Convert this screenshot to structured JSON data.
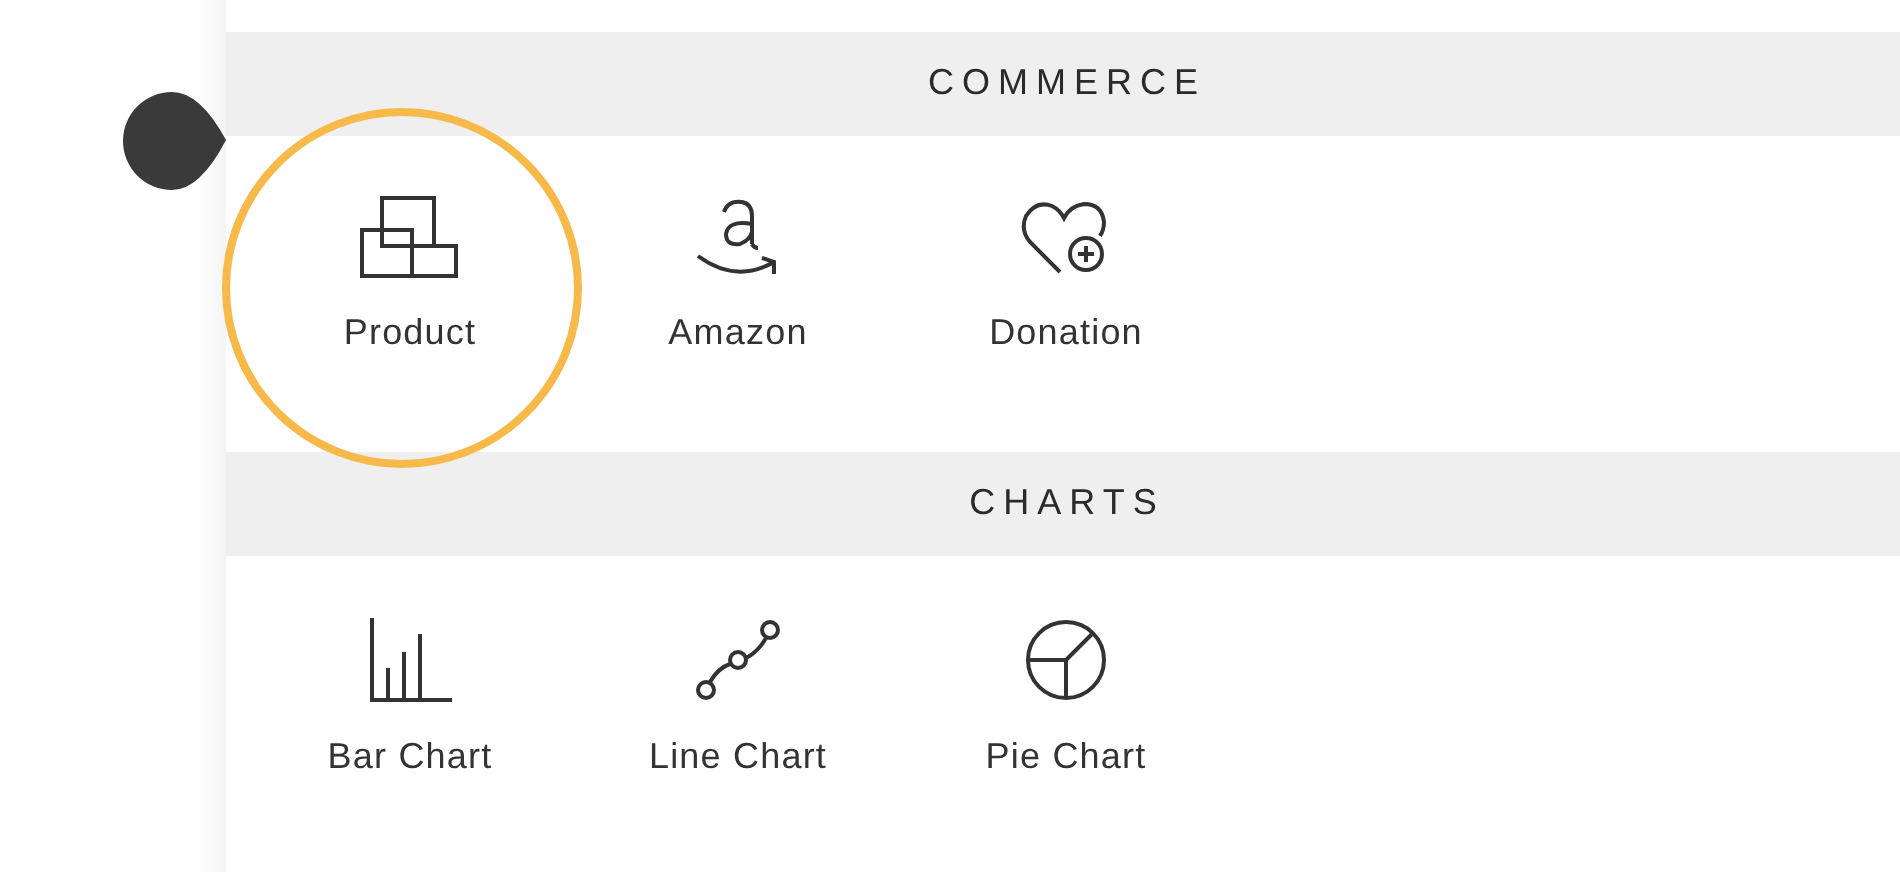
{
  "sections": [
    {
      "title": "COMMERCE",
      "items": [
        {
          "label": "Product",
          "kind": "boxes",
          "highlighted": true
        },
        {
          "label": "Amazon",
          "kind": "amazon",
          "highlighted": false
        },
        {
          "label": "Donation",
          "kind": "heart",
          "highlighted": false
        }
      ]
    },
    {
      "title": "CHARTS",
      "items": [
        {
          "label": "Bar Chart",
          "kind": "bar",
          "highlighted": false
        },
        {
          "label": "Line Chart",
          "kind": "line",
          "highlighted": false
        },
        {
          "label": "Pie Chart",
          "kind": "pie",
          "highlighted": false
        }
      ]
    }
  ]
}
